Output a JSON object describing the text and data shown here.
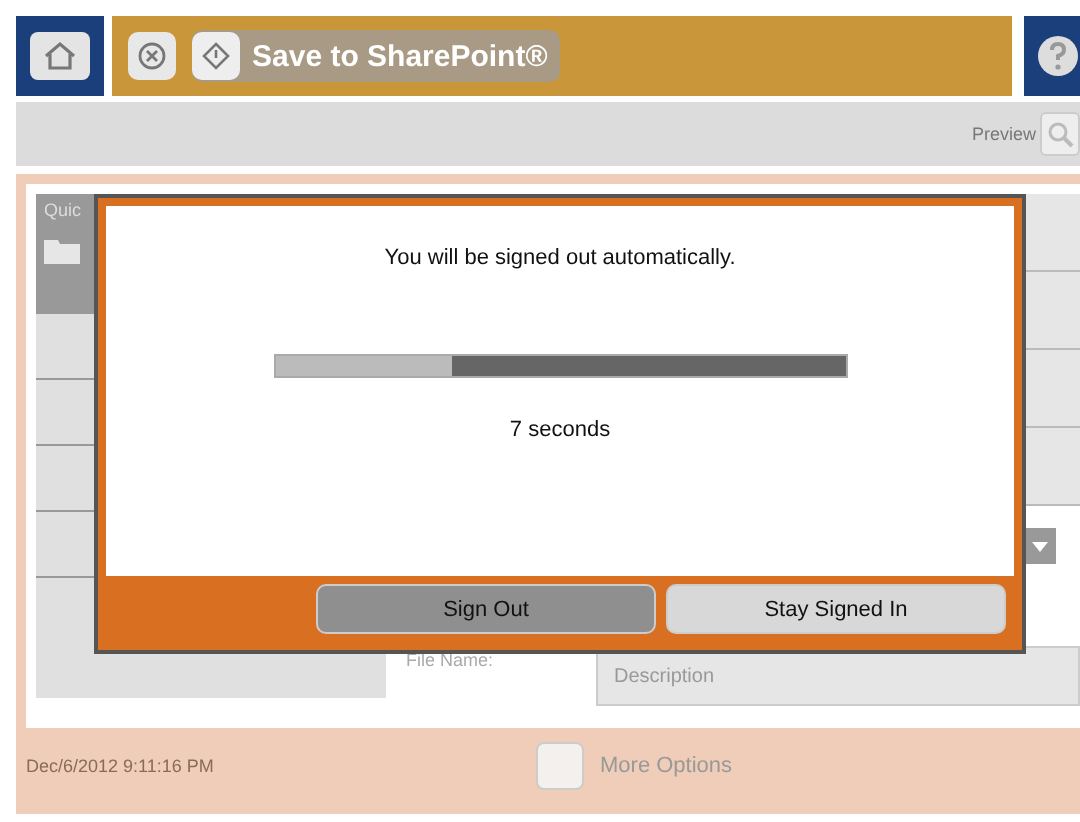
{
  "header": {
    "title": "Save to SharePoint®"
  },
  "toolbar": {
    "preview_label": "Preview"
  },
  "sidebar": {
    "label": "Quic"
  },
  "form": {
    "file_name_label": "File Name:",
    "description_placeholder": "Description"
  },
  "footer": {
    "timestamp": "Dec/6/2012 9:11:16 PM",
    "more_options": "More Options"
  },
  "dialog": {
    "message": "You will be signed out automatically.",
    "countdown": {
      "level": 0.31
    },
    "remaining": "7 seconds",
    "buttons": [
      {
        "label": "Sign Out",
        "kind": "dark"
      },
      {
        "label": "Stay Signed In",
        "kind": "light"
      }
    ]
  }
}
